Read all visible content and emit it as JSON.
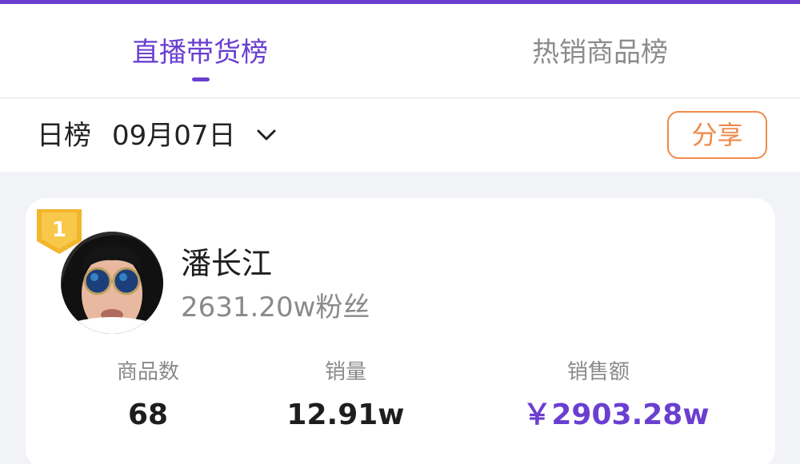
{
  "colors": {
    "accent": "#6a3fd0",
    "share": "#f08a4b",
    "rank_gold": "#f2b52c"
  },
  "tabs": [
    {
      "label": "直播带货榜",
      "active": true
    },
    {
      "label": "热销商品榜",
      "active": false
    }
  ],
  "filter": {
    "period": "日榜",
    "date": "09月07日",
    "share_label": "分享"
  },
  "ranking": [
    {
      "rank": "1",
      "name": "潘长江",
      "followers": "2631.20w粉丝",
      "stats": [
        {
          "label": "商品数",
          "value": "68"
        },
        {
          "label": "销量",
          "value": "12.91w"
        },
        {
          "label": "销售额",
          "value": "￥2903.28w"
        }
      ]
    }
  ]
}
